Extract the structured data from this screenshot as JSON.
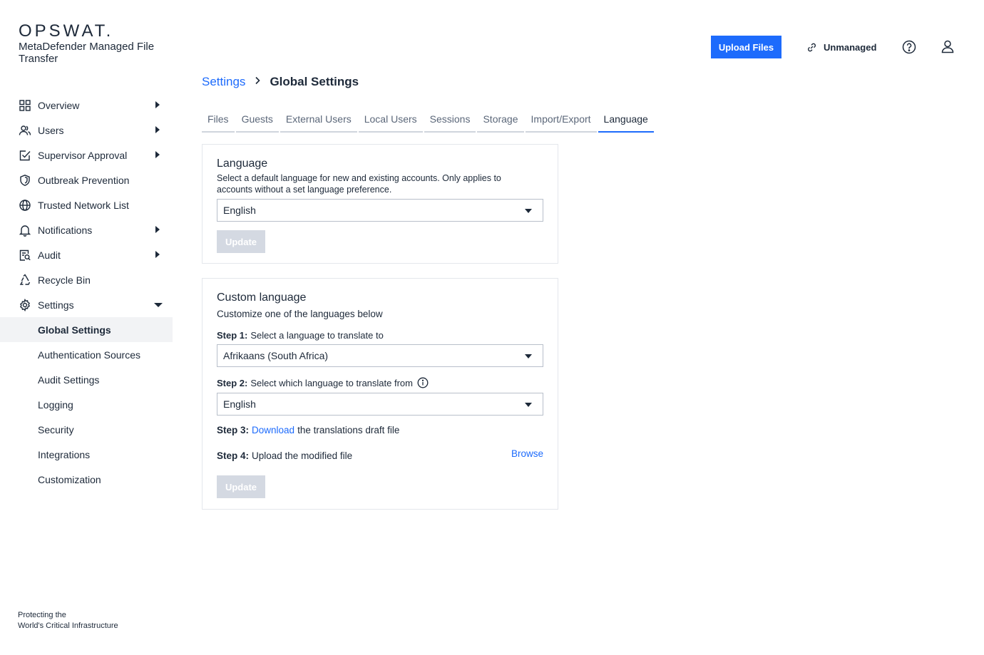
{
  "brand": {
    "logo": "OPSWAT.",
    "product": "MetaDefender Managed File Transfer",
    "tagline_1": "Protecting the",
    "tagline_2": "World's Critical Infrastructure"
  },
  "sidebar": {
    "items": [
      {
        "label": "Overview",
        "icon": "grid-icon"
      },
      {
        "label": "Users",
        "icon": "users-icon"
      },
      {
        "label": "Supervisor Approval",
        "icon": "approval-check-icon"
      },
      {
        "label": "Outbreak Prevention",
        "icon": "shield-icon"
      },
      {
        "label": "Trusted Network List",
        "icon": "globe-icon"
      },
      {
        "label": "Notifications",
        "icon": "bell-icon"
      },
      {
        "label": "Audit",
        "icon": "audit-icon"
      },
      {
        "label": "Recycle Bin",
        "icon": "recycle-icon"
      },
      {
        "label": "Settings",
        "icon": "gear-icon"
      }
    ],
    "settings_children": [
      "Global Settings",
      "Authentication Sources",
      "Audit Settings",
      "Logging",
      "Security",
      "Integrations",
      "Customization"
    ]
  },
  "header": {
    "upload_label": "Upload Files",
    "unmanaged_label": "Unmanaged"
  },
  "breadcrumb": {
    "parent": "Settings",
    "current": "Global Settings"
  },
  "tabs": [
    "Files",
    "Guests",
    "External Users",
    "Local Users",
    "Sessions",
    "Storage",
    "Import/Export",
    "Language"
  ],
  "active_tab": "Language",
  "language_panel": {
    "title": "Language",
    "description": "Select a default language for new and existing accounts. Only applies to accounts without a set language preference.",
    "selected": "English",
    "update_label": "Update"
  },
  "custom_panel": {
    "title": "Custom language",
    "description": "Customize one of the languages below",
    "step1_label": "Step 1:",
    "step1_text": "Select a language to translate to",
    "step1_selected": "Afrikaans (South Africa)",
    "step2_label": "Step 2:",
    "step2_text": "Select which language to translate from",
    "step2_selected": "English",
    "step3_label": "Step 3:",
    "step3_link": "Download",
    "step3_text": "the translations draft file",
    "step4_label": "Step 4:",
    "step4_text": "Upload the modified file",
    "browse_label": "Browse",
    "update_label": "Update"
  },
  "colors": {
    "accent": "#1d6bfc",
    "text": "#1d2939",
    "disabled_button": "#d4d9e2",
    "active_nav_bg": "#f2f3f5"
  }
}
